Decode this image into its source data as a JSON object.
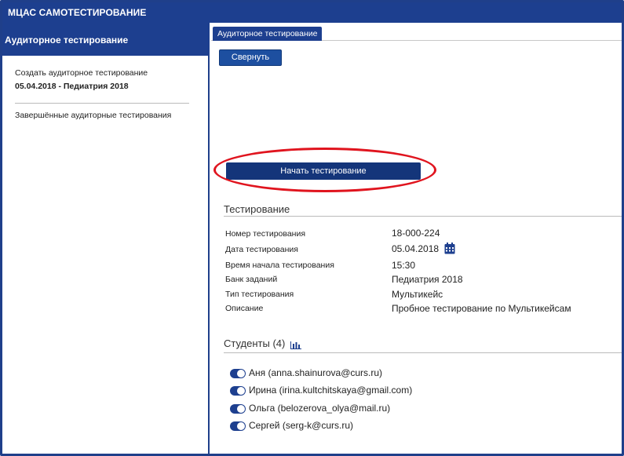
{
  "app": {
    "title": "МЦАС  САМОТЕСТИРОВАНИЕ"
  },
  "sidebar": {
    "title": "Аудиторное тестирование",
    "create_label": "Создать аудиторное тестирование",
    "current_item": "05.04.2018 - Педиатрия 2018",
    "finished_label": "Завершённые аудиторные тестирования"
  },
  "main": {
    "tab_label": "Аудиторное тестирование",
    "collapse_label": "Свернуть",
    "start_label": "Начать тестирование",
    "highlight_color": "#e0141e"
  },
  "testing": {
    "title": "Тестирование",
    "fields": [
      {
        "label": "Номер тестирования",
        "value": "18-000-224"
      },
      {
        "label": "Дата тестирования",
        "value": "05.04.2018"
      },
      {
        "label": "Время начала тестирования",
        "value": "15:30"
      },
      {
        "label": "Банк заданий",
        "value": "Педиатрия 2018"
      },
      {
        "label": "Тип тестирования",
        "value": "Мультикейс"
      },
      {
        "label": "Описание",
        "value": "Пробное тестирование по Мультикейсам"
      }
    ],
    "date_icon": "calendar-icon"
  },
  "students": {
    "title": "Студенты (4)",
    "stats_icon": "bar-chart-icon",
    "items": [
      {
        "name": "Аня (anna.shainurova@curs.ru)",
        "enabled": true
      },
      {
        "name": "Ирина (irina.kultchitskaya@gmail.com)",
        "enabled": true
      },
      {
        "name": "Ольга (belozerova_olya@mail.ru)",
        "enabled": true
      },
      {
        "name": "Сергей (serg-k@curs.ru)",
        "enabled": true
      }
    ]
  },
  "colors": {
    "brand": "#1d3f8f",
    "accent_red": "#e0141e"
  }
}
